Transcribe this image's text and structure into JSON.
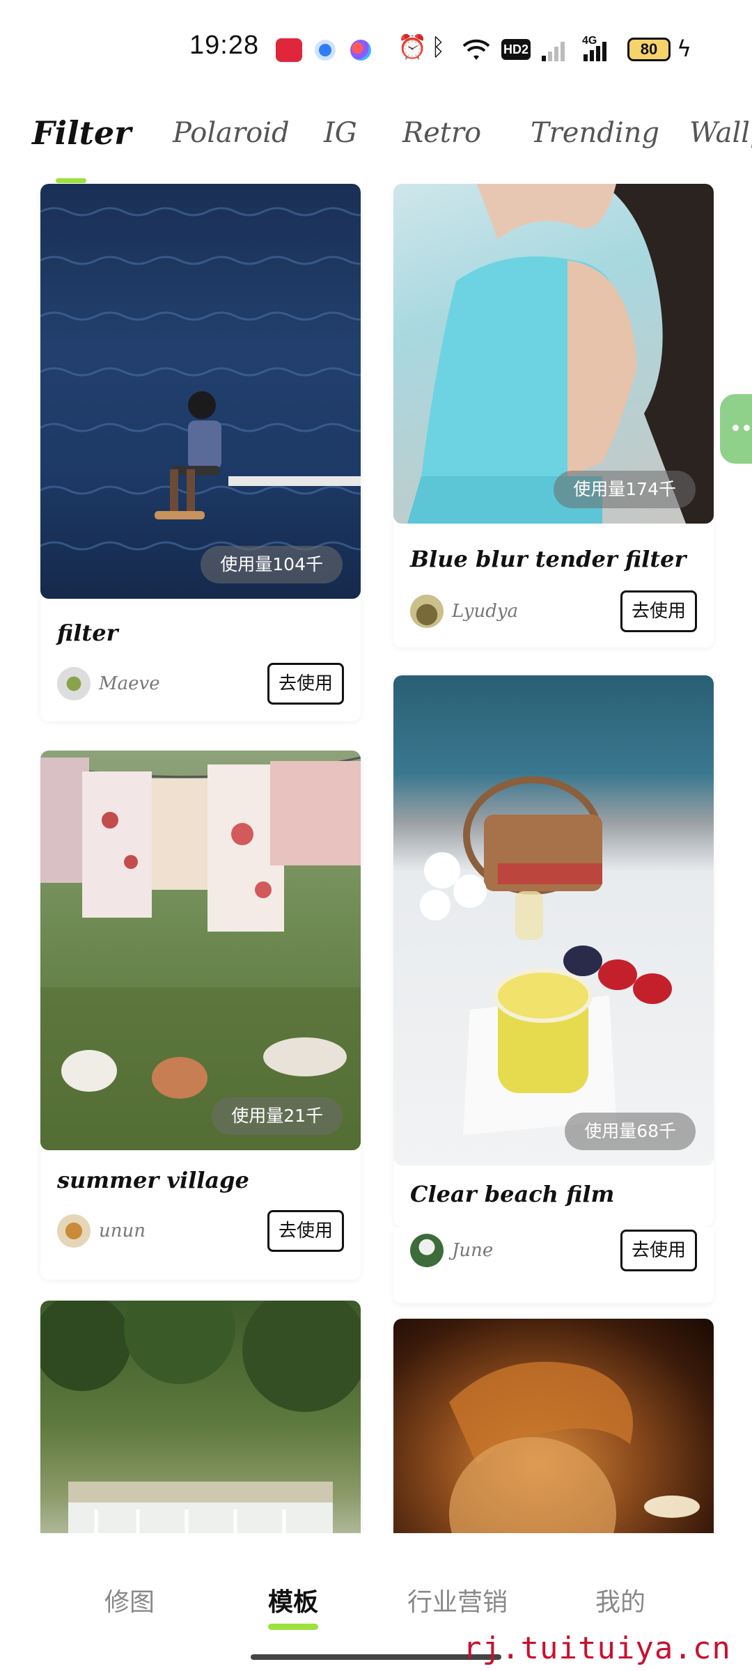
{
  "status_bar": {
    "time": "19:28",
    "hd_label": "HD2",
    "network_label": "4G",
    "battery": "80"
  },
  "tabs": [
    "Filter",
    "Polaroid",
    "IG",
    "Retro",
    "Trending",
    "Wallpa"
  ],
  "active_tab": "Filter",
  "cards": [
    {
      "usage": "使用量104千",
      "title": "filter",
      "author": "Maeve",
      "button": "去使用"
    },
    {
      "usage": "使用量174千",
      "title": "Blue blur tender filter",
      "author": "Lyudya",
      "button": "去使用"
    },
    {
      "usage": "使用量21千",
      "title": "summer village",
      "author": "unun",
      "button": "去使用"
    },
    {
      "usage": "使用量68千",
      "title": "Clear beach film",
      "author": "June",
      "button": "去使用"
    }
  ],
  "bottom_nav": [
    "修图",
    "模板",
    "行业营销",
    "我的"
  ],
  "active_nav": "模板",
  "watermark": "rj.tuituiya.cn",
  "colors": {
    "accent": "#9be23a",
    "float_handle": "#8fd18a"
  }
}
